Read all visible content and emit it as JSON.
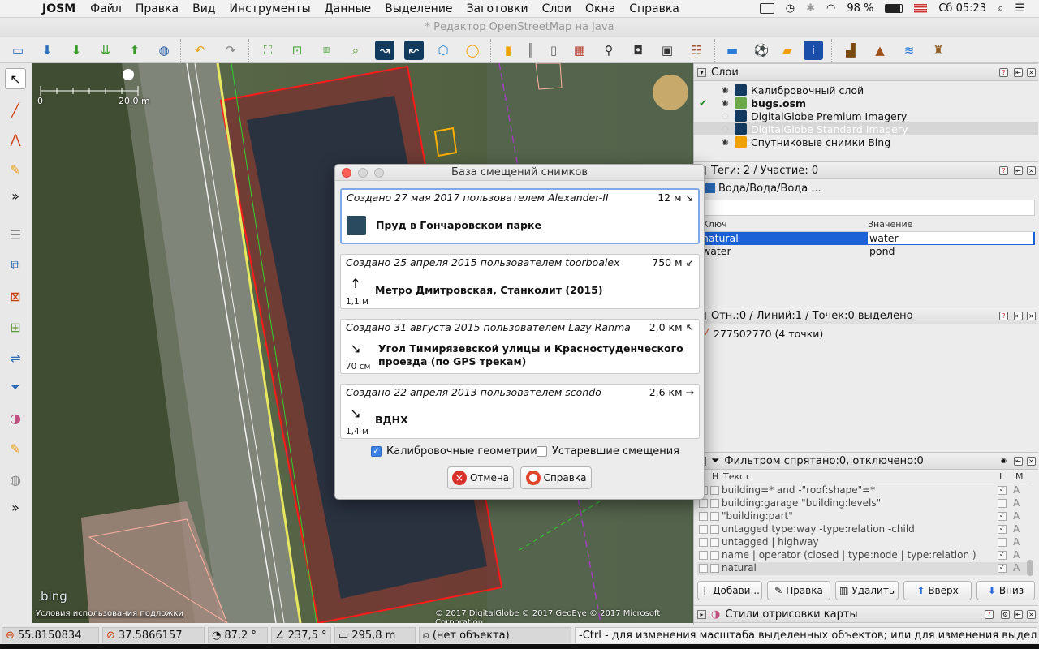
{
  "menubar": {
    "app": "JOSM",
    "items": [
      "Файл",
      "Правка",
      "Вид",
      "Инструменты",
      "Данные",
      "Выделение",
      "Заготовки",
      "Слои",
      "Окна",
      "Справка"
    ],
    "battery": "98 %",
    "clock": "Сб 05:23"
  },
  "window_title": "* Редактор OpenStreetMap на Java",
  "map": {
    "scale_start": "0",
    "scale_end": "20,0 m",
    "bing_logo": "bing",
    "terms": "Условия использования подложки",
    "copyright": "© 2017 DigitalGlobe © 2017 GeoEye © 2017 Microsoft Corporation"
  },
  "layers_panel": {
    "title": "Слои",
    "items": [
      {
        "name": "Калибровочный слой",
        "bold": false,
        "dim": false
      },
      {
        "name": "bugs.osm",
        "bold": true,
        "dim": false
      },
      {
        "name": "DigitalGlobe Premium Imagery",
        "bold": false,
        "dim": false
      },
      {
        "name": "DigitalGlobe Standard Imagery",
        "bold": false,
        "dim": true
      },
      {
        "name": "Спутниковые снимки Bing",
        "bold": false,
        "dim": false
      }
    ]
  },
  "tags_panel": {
    "title": "Теги: 2 / Участие: 0",
    "preset": "Вода/Вода/Вода ...",
    "col_key": "Ключ",
    "col_value": "Значение",
    "rows": [
      {
        "key": "natural",
        "value": "water"
      },
      {
        "key": "water",
        "value": "pond"
      }
    ]
  },
  "selection_panel": {
    "title": "Отн.:0 / Линий:1 / Точек:0 выделено",
    "item": "277502770 (4 точки)"
  },
  "filter_panel": {
    "title": "Фильтром спрятано:0, отключено:0",
    "col_h": "Н",
    "col_text": "Текст",
    "col_i": "I",
    "col_m": "M",
    "rows": [
      {
        "text": "building=* and -\"roof:shape\"=*",
        "i": true
      },
      {
        "text": "building:garage \"building:levels\"",
        "i": false
      },
      {
        "text": "\"building:part\"",
        "i": true
      },
      {
        "text": "untagged type:way -type:relation  -child",
        "i": true
      },
      {
        "text": "untagged | highway",
        "i": false
      },
      {
        "text": "name | operator (closed |  type:node |  type:relation )",
        "i": true
      },
      {
        "text": "natural",
        "i": true
      }
    ],
    "flag": "A",
    "buttons": {
      "add": "Добави...",
      "edit": "Правка",
      "delete": "Удалить",
      "up": "Вверх",
      "down": "Вниз"
    }
  },
  "styles_panel": {
    "title": "Стили отрисовки карты"
  },
  "dialog": {
    "title": "База смещений снимков",
    "offsets": [
      {
        "meta": "Создано 27 мая 2017 пользователем Alexander-II",
        "distance": "12 м",
        "arrow": "↘",
        "description": "Пруд в Гончаровском парке",
        "size": ""
      },
      {
        "meta": "Создано 25 апреля 2015 пользователем toorboalex",
        "distance": "750 м",
        "arrow": "↙",
        "description": "Метро Дмитровская, Станколит (2015)",
        "size": "1,1 м"
      },
      {
        "meta": "Создано 31 августа 2015 пользователем Lazy Ranma",
        "distance": "2,0 км",
        "arrow": "↖",
        "description": "Угол Тимирязевской улицы и Красностуденческого проезда (по GPS трекам)",
        "size": "70 см"
      },
      {
        "meta": "Создано 22 апреля 2013 пользователем scondo",
        "distance": "2,6 км",
        "arrow": "→",
        "description": "ВДНХ",
        "size": "1,4 м"
      }
    ],
    "calibration_label": "Калибровочные геометрии",
    "calibration_checked": true,
    "deprecated_label": "Устаревшие смещения",
    "deprecated_checked": false,
    "cancel": "Отмена",
    "help": "Справка"
  },
  "statusbar": {
    "lat": "55.8150834",
    "lon": "37.5866157",
    "heading": "87,2 °",
    "angle": "237,5 °",
    "distance": "295,8 m",
    "object": "(нет объекта)",
    "hint": "-Ctrl - для изменения масштаба выделенных объектов; или для изменения выделения"
  }
}
